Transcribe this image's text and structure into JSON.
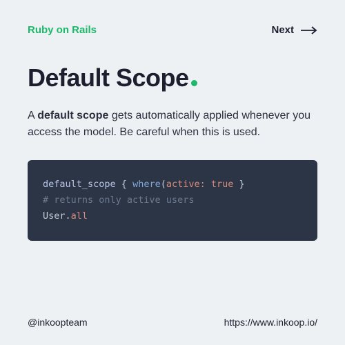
{
  "header": {
    "brand": "Ruby on Rails",
    "next_label": "Next"
  },
  "title": "Default Scope",
  "description": {
    "prefix": "A ",
    "bold": "default scope",
    "suffix": " gets automatically applied whenever you access the model. Be careful when this is used."
  },
  "code": {
    "line1": {
      "method": "default_scope",
      "brace_open": " { ",
      "func": "where",
      "paren_open": "(",
      "symbol": "active:",
      "space": " ",
      "value": "true",
      "brace_close": " }"
    },
    "line2": "",
    "line3": "# returns only active users",
    "line4": {
      "class": "User",
      "dot": ".",
      "call": "all"
    }
  },
  "footer": {
    "handle": "@inkoopteam",
    "url": "https://www.inkoop.io/"
  }
}
